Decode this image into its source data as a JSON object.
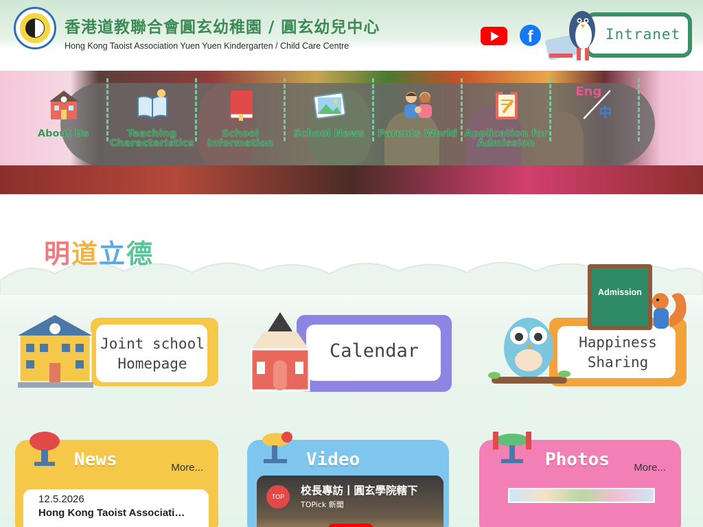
{
  "header": {
    "school_name_zh": "香港道教聯合會圓玄幼稚園 / 圓玄幼兒中心",
    "school_name_en": "Hong Kong Taoist Association Yuen Yuen Kindergarten / Child Care Centre",
    "intranet_label": "Intranet",
    "social": {
      "youtube_icon": "youtube-icon",
      "facebook_icon": "facebook-icon"
    },
    "accent": "#3b8f66"
  },
  "nav": {
    "items": [
      {
        "label": "About Us",
        "icon": "school-building-icon"
      },
      {
        "label": "Teaching Characteristics",
        "icon": "open-book-icon"
      },
      {
        "label": "School Information",
        "icon": "red-book-icon"
      },
      {
        "label": "School News",
        "icon": "photo-news-icon"
      },
      {
        "label": "Parents World",
        "icon": "family-icon"
      },
      {
        "label": "Application for Admission",
        "icon": "clipboard-icon"
      },
      {
        "label": "Eng / 中",
        "icon": "language-toggle-icon"
      }
    ]
  },
  "motto": [
    "明",
    "道",
    "立",
    "德"
  ],
  "quick_links": {
    "joint": {
      "label_line1": "Joint school",
      "label_line2": "Homepage"
    },
    "calendar": {
      "label": "Calendar"
    },
    "happiness": {
      "label_line1": "Happiness",
      "label_line2": "Sharing",
      "badge": "Admission"
    }
  },
  "panels": {
    "news": {
      "title": "News",
      "more": "More...",
      "date": "12.5.2026",
      "headline": "Hong Kong Taoist Associati…"
    },
    "video": {
      "title": "Video",
      "video_title": "校長專訪丨圓玄學院轄下",
      "channel": "TOPick 新聞"
    },
    "photos": {
      "title": "Photos",
      "more": "More..."
    }
  }
}
